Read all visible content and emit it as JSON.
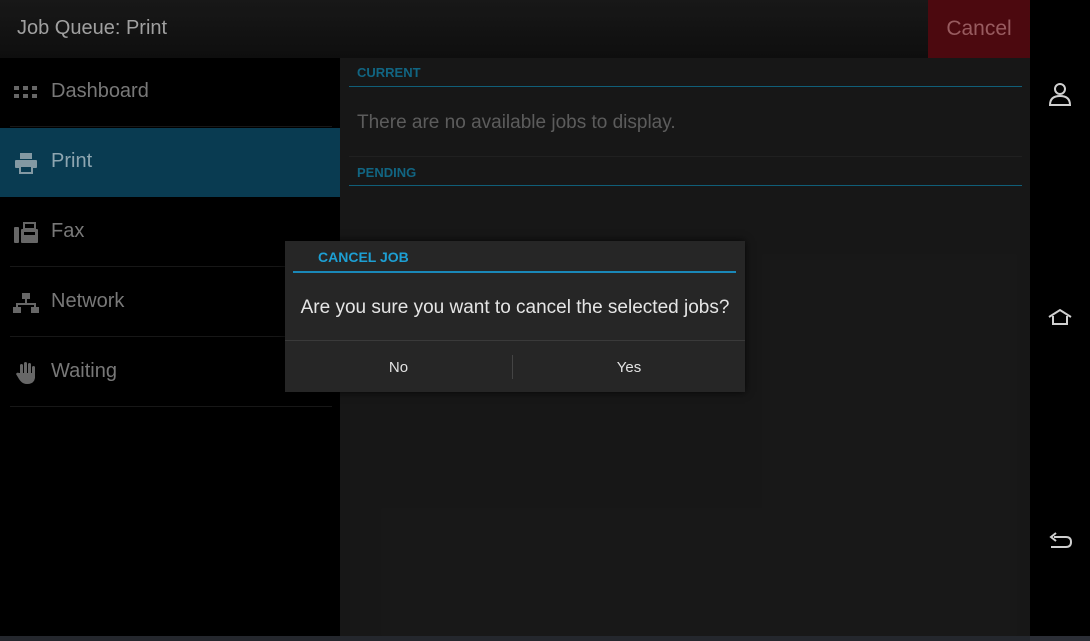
{
  "header": {
    "title": "Job Queue: Print",
    "cancel_label": "Cancel"
  },
  "sidebar": {
    "items": [
      {
        "label": "Dashboard",
        "icon": "dashboard-grid-icon",
        "active": false
      },
      {
        "label": "Print",
        "icon": "printer-icon",
        "active": true
      },
      {
        "label": "Fax",
        "icon": "fax-icon",
        "active": false
      },
      {
        "label": "Network",
        "icon": "network-icon",
        "active": false
      },
      {
        "label": "Waiting",
        "icon": "hand-icon",
        "active": false
      }
    ]
  },
  "main": {
    "current_heading": "CURRENT",
    "empty_message": "There are no available jobs to display.",
    "pending_heading": "PENDING"
  },
  "dialog": {
    "title": "CANCEL JOB",
    "message": "Are you sure you want to cancel the selected jobs?",
    "no_label": "No",
    "yes_label": "Yes"
  },
  "system_nav": {
    "icons": [
      "user-icon",
      "home-icon",
      "back-icon"
    ]
  },
  "colors": {
    "accent": "#1d9fd3",
    "active_nav": "#0b4660",
    "cancel": "#5a0b12"
  }
}
